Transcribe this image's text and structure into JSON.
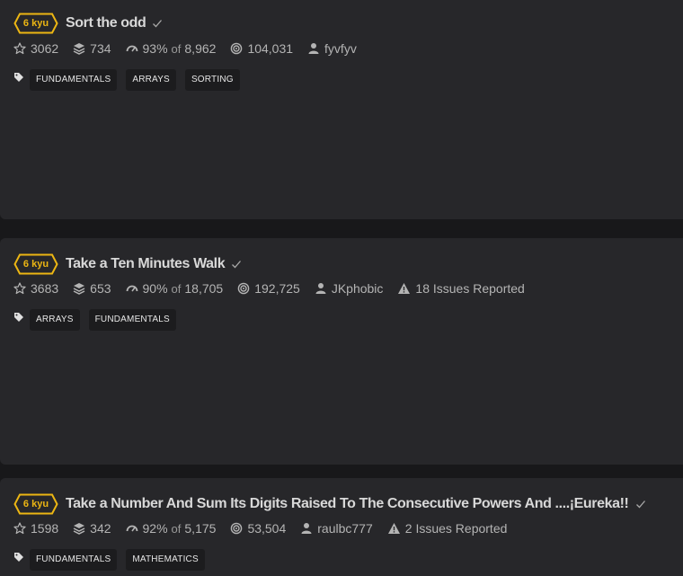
{
  "kata": [
    {
      "rank": "6 kyu",
      "name": "Sort the odd",
      "stars": "3062",
      "collections": "734",
      "satisfaction": "93%",
      "of_label": "of",
      "votes": "8,962",
      "completions": "104,031",
      "author": "fyvfyv",
      "issues": "",
      "tags": [
        "FUNDAMENTALS",
        "ARRAYS",
        "SORTING"
      ]
    },
    {
      "rank": "6 kyu",
      "name": "Take a Ten Minutes Walk",
      "stars": "3683",
      "collections": "653",
      "satisfaction": "90%",
      "of_label": "of",
      "votes": "18,705",
      "completions": "192,725",
      "author": "JKphobic",
      "issues": "18 Issues Reported",
      "tags": [
        "ARRAYS",
        "FUNDAMENTALS"
      ]
    },
    {
      "rank": "6 kyu",
      "name": "Take a Number And Sum Its Digits Raised To The Consecutive Powers And ....¡Eureka!!",
      "stars": "1598",
      "collections": "342",
      "satisfaction": "92%",
      "of_label": "of",
      "votes": "5,175",
      "completions": "53,504",
      "author": "raulbc777",
      "issues": "2 Issues Reported",
      "tags": [
        "FUNDAMENTALS",
        "MATHEMATICS"
      ]
    }
  ],
  "colors": {
    "background": "#18181a",
    "card": "#27272a",
    "rank_yellow": "#ecb613",
    "tag_bg": "#1c1c1e"
  }
}
